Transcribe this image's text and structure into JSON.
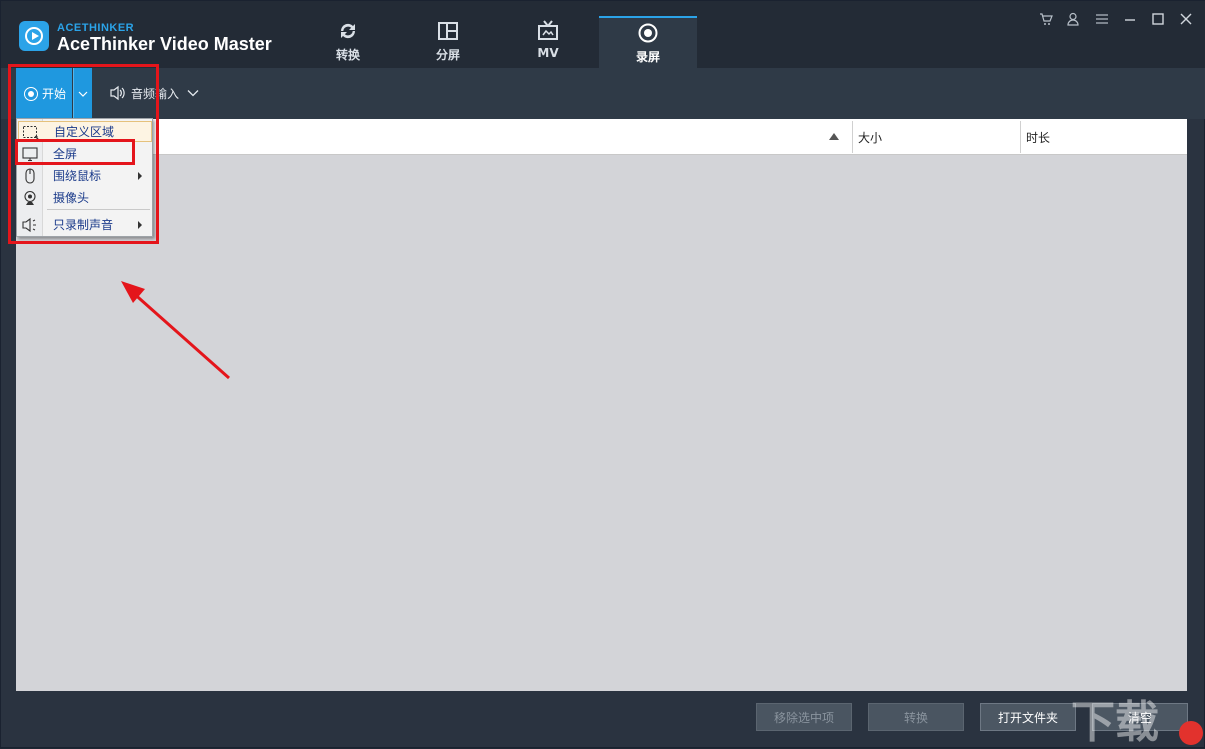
{
  "app": {
    "brand_small": "ACETHINKER",
    "brand_title": "AceThinker Video Master"
  },
  "tabs": [
    {
      "label": "转换",
      "icon": "refresh-icon",
      "active": false
    },
    {
      "label": "分屏",
      "icon": "split-screen-icon",
      "active": false
    },
    {
      "label": "MV",
      "icon": "tv-icon",
      "active": false
    },
    {
      "label": "录屏",
      "icon": "record-icon",
      "active": true
    }
  ],
  "window_controls": [
    "cart-icon",
    "user-icon",
    "menu-icon",
    "minimize-icon",
    "maximize-icon",
    "close-icon"
  ],
  "toolbar": {
    "start_label": "开始",
    "audio_label": "音频输入"
  },
  "table": {
    "columns": [
      "",
      "大小",
      "时长"
    ]
  },
  "dropdown": {
    "items": [
      {
        "label": "自定义区域",
        "icon": "region-select-icon",
        "submenu": false
      },
      {
        "label": "全屏",
        "icon": "monitor-icon",
        "submenu": false
      },
      {
        "label": "围绕鼠标",
        "icon": "mouse-icon",
        "submenu": true
      },
      {
        "label": "摄像头",
        "icon": "webcam-icon",
        "submenu": false
      },
      {
        "label": "只录制声音",
        "icon": "speaker-icon",
        "submenu": true
      }
    ]
  },
  "footer": {
    "remove_label": "移除选中项",
    "convert_label": "转换",
    "open_folder_label": "打开文件夹",
    "extra_label": "清空"
  },
  "colors": {
    "accent": "#1f98df",
    "annotation": "#e4151b",
    "titlebar": "#232b36",
    "content": "#d3d4d8"
  }
}
